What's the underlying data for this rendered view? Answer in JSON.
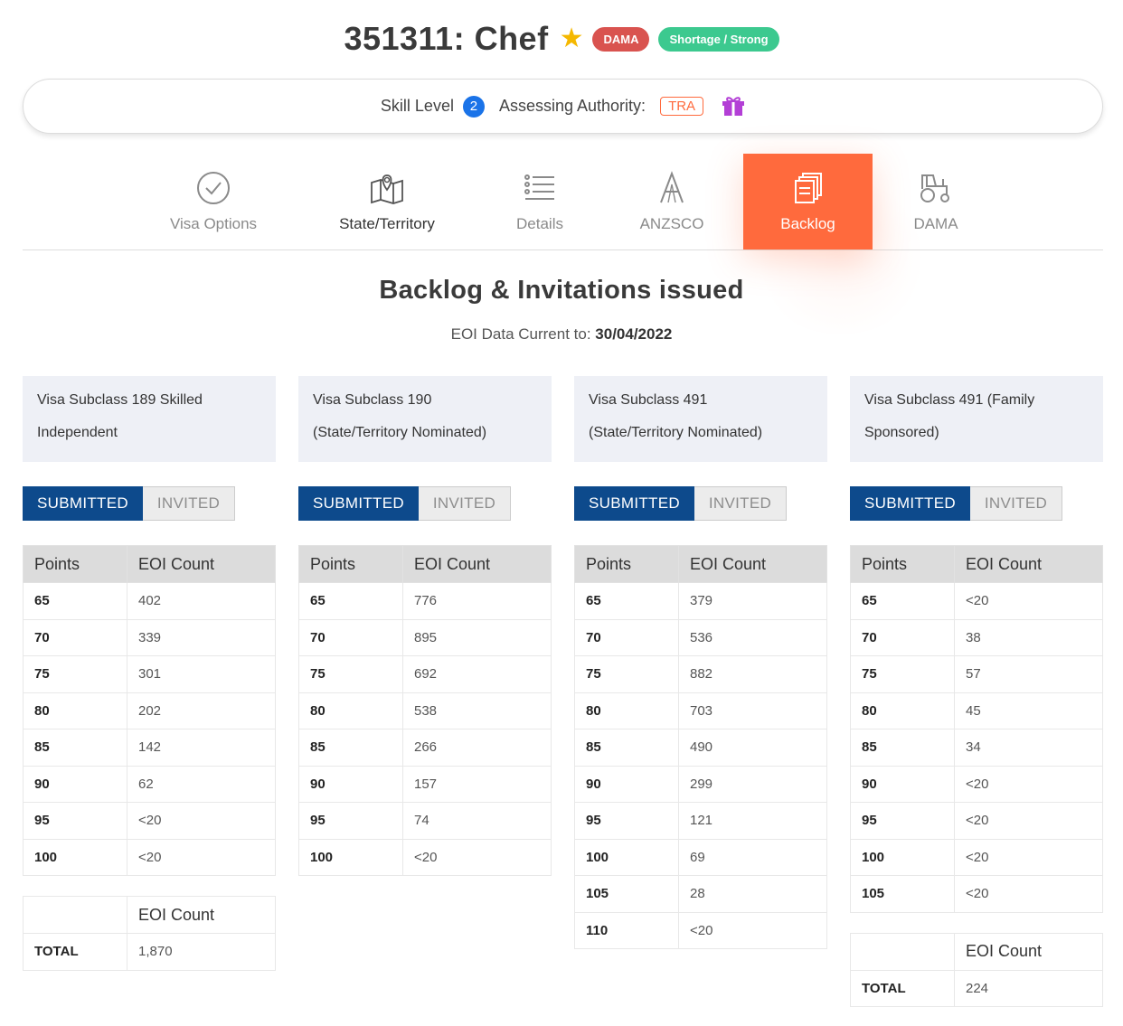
{
  "header": {
    "title": "351311: Chef",
    "badges": [
      "DAMA",
      "Shortage / Strong"
    ]
  },
  "info": {
    "skill_level_label": "Skill Level",
    "skill_level": "2",
    "authority_label": "Assessing Authority:",
    "authority": "TRA",
    "gift_icon": "gift-icon"
  },
  "tabs": [
    {
      "label": "Visa Options",
      "icon": "check-circle-icon"
    },
    {
      "label": "State/Territory",
      "icon": "map-pin-icon"
    },
    {
      "label": "Details",
      "icon": "list-icon"
    },
    {
      "label": "ANZSCO",
      "icon": "letter-a-icon"
    },
    {
      "label": "Backlog",
      "icon": "files-icon",
      "active": true
    },
    {
      "label": "DAMA",
      "icon": "tractor-icon"
    }
  ],
  "section": {
    "title": "Backlog & Invitations issued",
    "date_label": "EOI Data Current to:",
    "date": "30/04/2022"
  },
  "toggle": {
    "submitted": "SUBMITTED",
    "invited": "INVITED"
  },
  "table_headers": {
    "points": "Points",
    "count": "EOI Count",
    "total": "TOTAL"
  },
  "columns": [
    {
      "line1": "Visa Subclass 189 Skilled",
      "line2": "Independent",
      "rows": [
        [
          "65",
          "402"
        ],
        [
          "70",
          "339"
        ],
        [
          "75",
          "301"
        ],
        [
          "80",
          "202"
        ],
        [
          "85",
          "142"
        ],
        [
          "90",
          "62"
        ],
        [
          "95",
          "<20"
        ],
        [
          "100",
          "<20"
        ]
      ],
      "total": "1,870"
    },
    {
      "line1": "Visa Subclass 190",
      "line2": "(State/Territory Nominated)",
      "rows": [
        [
          "65",
          "776"
        ],
        [
          "70",
          "895"
        ],
        [
          "75",
          "692"
        ],
        [
          "80",
          "538"
        ],
        [
          "85",
          "266"
        ],
        [
          "90",
          "157"
        ],
        [
          "95",
          "74"
        ],
        [
          "100",
          "<20"
        ]
      ],
      "total": null
    },
    {
      "line1": "Visa Subclass 491",
      "line2": "(State/Territory Nominated)",
      "rows": [
        [
          "65",
          "379"
        ],
        [
          "70",
          "536"
        ],
        [
          "75",
          "882"
        ],
        [
          "80",
          "703"
        ],
        [
          "85",
          "490"
        ],
        [
          "90",
          "299"
        ],
        [
          "95",
          "121"
        ],
        [
          "100",
          "69"
        ],
        [
          "105",
          "28"
        ],
        [
          "110",
          "<20"
        ]
      ],
      "total": null
    },
    {
      "line1": "Visa Subclass 491 (Family",
      "line2": "Sponsored)",
      "rows": [
        [
          "65",
          "<20"
        ],
        [
          "70",
          "38"
        ],
        [
          "75",
          "57"
        ],
        [
          "80",
          "45"
        ],
        [
          "85",
          "34"
        ],
        [
          "90",
          "<20"
        ],
        [
          "95",
          "<20"
        ],
        [
          "100",
          "<20"
        ],
        [
          "105",
          "<20"
        ]
      ],
      "total": "224"
    }
  ],
  "colors": {
    "accent": "#ff6a3d",
    "primary": "#0d4a8c",
    "dama": "#d9534f",
    "shortage": "#3cc98f"
  }
}
